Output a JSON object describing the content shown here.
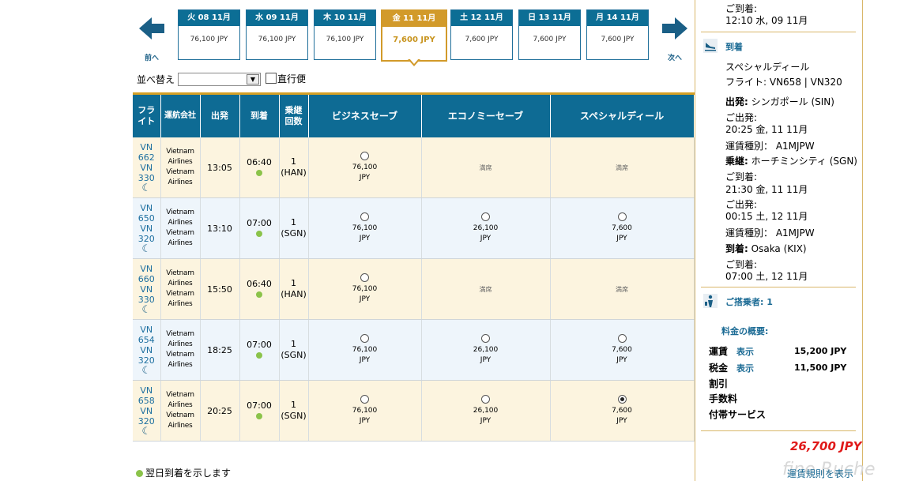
{
  "date_strip": {
    "prev_label": "前へ",
    "next_label": "次へ",
    "dates": [
      {
        "day": "火 08 11月",
        "price": "76,100 JPY",
        "selected": false
      },
      {
        "day": "水 09 11月",
        "price": "76,100 JPY",
        "selected": false
      },
      {
        "day": "木 10 11月",
        "price": "76,100 JPY",
        "selected": false
      },
      {
        "day": "金 11 11月",
        "price": "7,600 JPY",
        "selected": true
      },
      {
        "day": "土 12 11月",
        "price": "7,600 JPY",
        "selected": false
      },
      {
        "day": "日 13 11月",
        "price": "7,600 JPY",
        "selected": false
      },
      {
        "day": "月 14 11月",
        "price": "7,600 JPY",
        "selected": false
      }
    ]
  },
  "sort": {
    "label": "並べ替え",
    "value": "",
    "direct_label": "直行便"
  },
  "table": {
    "headers": {
      "flight": "フライト",
      "carrier": "運航会社",
      "depart": "出発",
      "arrive": "到着",
      "stops": "乗継回数",
      "business": "ビジネスセーブ",
      "economy": "エコノミーセーブ",
      "special": "スペシャルディール"
    },
    "rows": [
      {
        "flight1": "VN",
        "flight2": "662",
        "flight3": "VN",
        "flight4": "330",
        "carrier1": "Vietnam",
        "carrier2": "Airlines",
        "carrier3": "Vietnam",
        "carrier4": "Airlines",
        "depart": "13:05",
        "arrive": "06:40",
        "stops": "1",
        "via": "(HAN)",
        "business": "76,100",
        "economy": "満席",
        "special": "満席"
      },
      {
        "flight1": "VN",
        "flight2": "650",
        "flight3": "VN",
        "flight4": "320",
        "carrier1": "Vietnam",
        "carrier2": "Airlines",
        "carrier3": "Vietnam",
        "carrier4": "Airlines",
        "depart": "13:10",
        "arrive": "07:00",
        "stops": "1",
        "via": "(SGN)",
        "business": "76,100",
        "economy": "26,100",
        "special": "7,600"
      },
      {
        "flight1": "VN",
        "flight2": "660",
        "flight3": "VN",
        "flight4": "330",
        "carrier1": "Vietnam",
        "carrier2": "Airlines",
        "carrier3": "Vietnam",
        "carrier4": "Airlines",
        "depart": "15:50",
        "arrive": "06:40",
        "stops": "1",
        "via": "(HAN)",
        "business": "76,100",
        "economy": "満席",
        "special": "満席"
      },
      {
        "flight1": "VN",
        "flight2": "654",
        "flight3": "VN",
        "flight4": "320",
        "carrier1": "Vietnam",
        "carrier2": "Airlines",
        "carrier3": "Vietnam",
        "carrier4": "Airlines",
        "depart": "18:25",
        "arrive": "07:00",
        "stops": "1",
        "via": "(SGN)",
        "business": "76,100",
        "economy": "26,100",
        "special": "7,600"
      },
      {
        "flight1": "VN",
        "flight2": "658",
        "flight3": "VN",
        "flight4": "320",
        "carrier1": "Vietnam",
        "carrier2": "Airlines",
        "carrier3": "Vietnam",
        "carrier4": "Airlines",
        "depart": "20:25",
        "arrive": "07:00",
        "stops": "1",
        "via": "(SGN)",
        "business": "76,100",
        "economy": "26,100",
        "special": "7,600"
      }
    ],
    "currency": "JPY",
    "selected_row": 4,
    "selected_fare": "special"
  },
  "legend": "翌日到着を示します",
  "summary": {
    "top_arrival_label": "ご到着:",
    "top_arrival_value": "12:10 水, 09 11月",
    "arrival_section": "到着",
    "fare_name": "スペシャルディール",
    "flight_line": "フライト: VN658 | VN320",
    "depart_label": "出発:",
    "depart_value": "シンガポール (SIN)",
    "seg1_dep_label": "ご出発:",
    "seg1_dep_value": "20:25 金, 11 11月",
    "fare_type1": "運賃種別： A1MJPW",
    "transit_label": "乗継:",
    "transit_value": "ホーチミンシティ (SGN)",
    "seg1_arr_label": "ご到着:",
    "seg1_arr_value": "21:30 金, 11 11月",
    "seg2_dep_label": "ご出発:",
    "seg2_dep_value": "00:15 土, 12 11月",
    "fare_type2": "運賃種別： A1MJPW",
    "arrive_label": "到着:",
    "arrive_value": "Osaka (KIX)",
    "seg2_arr_label": "ご到着:",
    "seg2_arr_value": "07:00 土, 12 11月",
    "passengers": "ご搭乗者: 1",
    "fare_overview": "料金の概要:",
    "fare_label": "運賃",
    "fare_show": "表示",
    "fare_amount": "15,200 JPY",
    "tax_label": "税金",
    "tax_show": "表示",
    "tax_amount": "11,500 JPY",
    "discount_label": "割引",
    "fee_label": "手数料",
    "extras_label": "付帯サービス",
    "total": "26,700 JPY",
    "rules_link": "運賃規則を表示"
  },
  "watermark": "fine Ruche",
  "colors": {
    "header": "#0e6b94",
    "accent": "#d29a2a",
    "total": "#e01a1a",
    "odd_row": "#fcf4df",
    "even_row": "#eef5fb"
  }
}
